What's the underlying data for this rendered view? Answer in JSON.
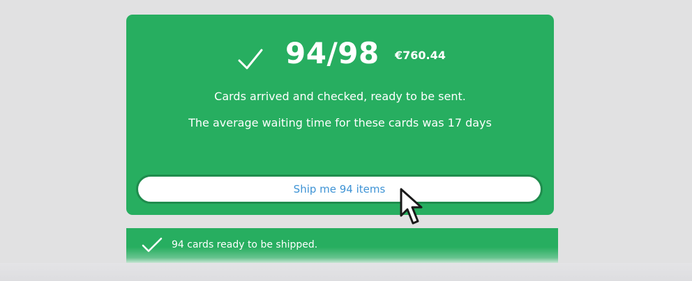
{
  "status_card": {
    "count": "94/98",
    "price": "€760.44",
    "message_arrived": "Cards arrived and checked, ready to be sent.",
    "message_waiting": "The average waiting time for these cards was 17 days",
    "ship_button_label": "Ship me 94 items",
    "check_icon": "checkmark-icon"
  },
  "notice": {
    "text": "94 cards ready to be shipped.",
    "icon": "checkmark-icon"
  },
  "cursor": {
    "icon": "pointer-cursor-icon"
  },
  "colors": {
    "background": "#e1e1e2",
    "card_green": "#27ae60",
    "button_border": "#1f8c4d",
    "button_text": "#3e93d5",
    "text_white": "#ffffff"
  }
}
